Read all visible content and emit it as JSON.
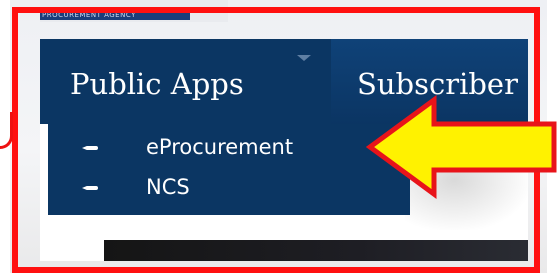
{
  "site": {
    "logo_text": "PROCUREMENT AGENCY"
  },
  "navbar": {
    "items": [
      {
        "label": "Public Apps",
        "expanded": true
      },
      {
        "label": "Subscriber"
      }
    ]
  },
  "dropdown": {
    "items": [
      {
        "label": "eProcurement",
        "highlighted": true
      },
      {
        "label": "NCS"
      }
    ]
  },
  "annotation": {
    "box_color": "#ff1010",
    "arrow_fill": "#fff200",
    "arrow_stroke": "#e8141a",
    "points_to": "eProcurement"
  },
  "colors": {
    "navbar": "#0b3663",
    "nav_text": "#ffffff"
  }
}
